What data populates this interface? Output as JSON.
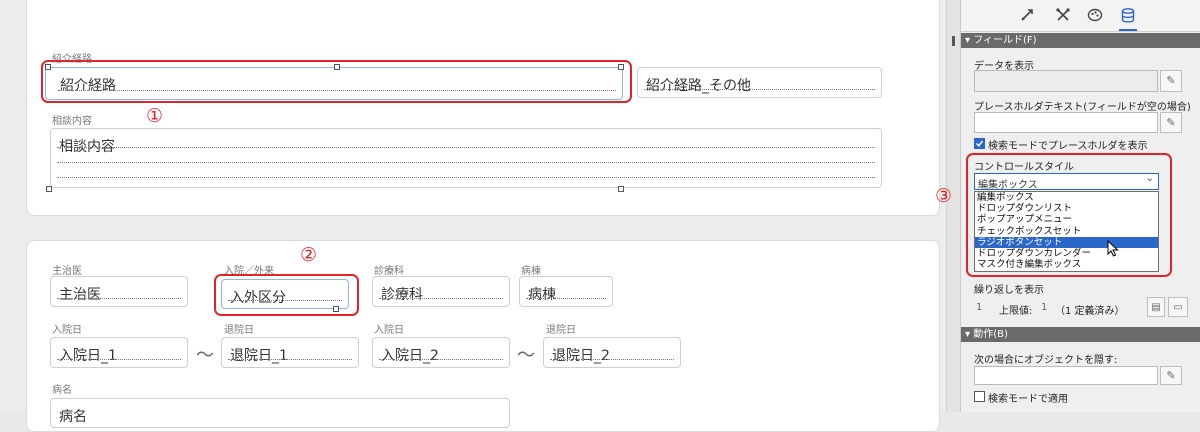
{
  "canvas": {
    "top_card": {
      "referral_label": "紹介経路",
      "referral_value": "紹介経路",
      "referral_other_value": "紹介経路_その他",
      "consult_label": "相談内容",
      "consult_value": "相談内容"
    },
    "bottom_card": {
      "doctor_label": "主治医",
      "doctor_value": "主治医",
      "inout_label": "入院／外来",
      "inout_value": "入外区分",
      "dept_label": "診療科",
      "dept_value": "診療科",
      "ward_label": "病棟",
      "ward_value": "病棟",
      "admit1_label": "入院日",
      "admit1_value": "入院日_1",
      "discharge1_label": "退院日",
      "discharge1_value": "退院日_1",
      "admit2_label": "入院日",
      "admit2_value": "入院日_2",
      "discharge2_label": "退院日",
      "discharge2_value": "退院日_2",
      "tilde": "～",
      "disease_label": "病名",
      "disease_value": "病名"
    },
    "markers": {
      "m1": "①",
      "m2": "②",
      "m3": "③"
    }
  },
  "inspector": {
    "tabs": [
      "position-icon",
      "appearance-icon",
      "theme-icon",
      "data-icon"
    ],
    "field_section": {
      "title": "▾ フィールド(F)",
      "show_data_label": "データを表示",
      "placeholder_label": "プレースホルダテキスト(フィールドが空の場合)",
      "search_mode_placeholder": "検索モードでプレースホルダを表示",
      "control_style_label": "コントロールスタイル",
      "control_style_value": "編集ボックス",
      "options": [
        "編集ボックス",
        "ドロップダウンリスト",
        "ポップアップメニュー",
        "チェックボックスセット",
        "ラジオボタンセット",
        "ドロップダウンカレンダー",
        "マスク付き編集ボックス"
      ],
      "selected_option": "ラジオボタンセット",
      "repeat_label": "繰り返しを表示",
      "repeat_start": "1",
      "upper_limit_label": "上限値:",
      "upper_limit_value": "1",
      "defined_note": "（1 定義済み）"
    },
    "behavior_section": {
      "title": "▾ 動作(B)",
      "hide_label": "次の場合にオブジェクトを隠す:",
      "apply_search_mode": "検索モードで適用"
    },
    "pencil_glyph": "✎",
    "colors": {
      "accent": "#2a67c9",
      "annotation_red": "#e0242b",
      "section_header": "#6a6a6a"
    }
  }
}
